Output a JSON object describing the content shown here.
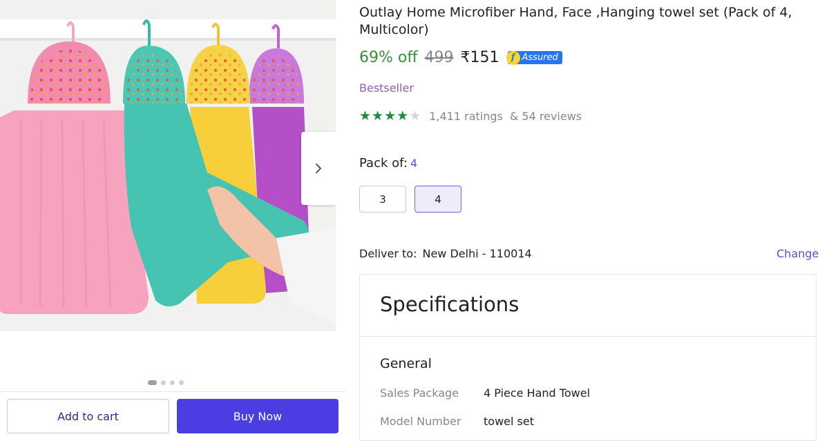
{
  "product": {
    "title": "Outlay Home Microfiber Hand, Face ,Hanging towel set (Pack of 4, Multicolor)",
    "discount": "69% off",
    "mrp": "499",
    "price": "₹151",
    "assured_label": "Assured",
    "assured_logo": "f",
    "badge": "Bestseller",
    "rating": {
      "stars_filled": 4,
      "stars_total": 5,
      "ratings_text": "1,411 ratings",
      "reviews_text": "& 54 reviews"
    }
  },
  "pack": {
    "label": "Pack of:",
    "selected": "4",
    "options": [
      "3",
      "4"
    ]
  },
  "delivery": {
    "label": "Deliver to:",
    "location": "New Delhi - 110014",
    "change_label": "Change"
  },
  "specifications": {
    "title": "Specifications",
    "section": "General",
    "rows": [
      {
        "key": "Sales Package",
        "value": "4 Piece Hand Towel"
      },
      {
        "key": "Model Number",
        "value": "towel set"
      }
    ]
  },
  "gallery": {
    "image_count": 4,
    "active_index": 0,
    "next_icon": "chevron-right-icon"
  },
  "actions": {
    "add_to_cart": "Add to cart",
    "buy_now": "Buy Now"
  },
  "colors": {
    "discount": "#388e3c",
    "accent": "#4a3de2",
    "assured": "#2874f0",
    "bestseller": "#8e5fb0"
  }
}
